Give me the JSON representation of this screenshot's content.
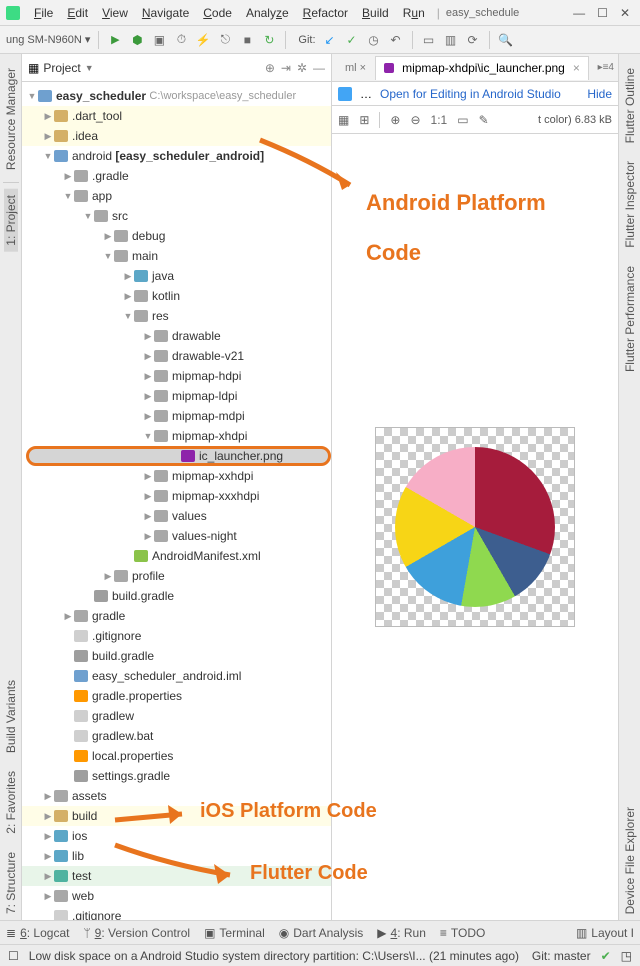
{
  "menu": {
    "file": "File",
    "edit": "Edit",
    "view": "View",
    "navigate": "Navigate",
    "code": "Code",
    "analyze": "Analyze",
    "refactor": "Refactor",
    "build": "Build",
    "run": "Run",
    "crumb": "easy_schedule"
  },
  "win": {
    "min": "—",
    "max": "☐",
    "close": "✕"
  },
  "toolbar": {
    "device": "ung SM-N960N ▾",
    "git": "Git:"
  },
  "project": {
    "header": "Project",
    "root": "easy_scheduler",
    "rootpath": "C:\\workspace\\easy_scheduler"
  },
  "tree": {
    "dart_tool": ".dart_tool",
    "idea": ".idea",
    "android": "android",
    "android_mod": "[easy_scheduler_android]",
    "gradle_dir": ".gradle",
    "app": "app",
    "src": "src",
    "debug": "debug",
    "main": "main",
    "java": "java",
    "kotlin": "kotlin",
    "res": "res",
    "drawable": "drawable",
    "drawable_v21": "drawable-v21",
    "mipmap_hdpi": "mipmap-hdpi",
    "mipmap_ldpi": "mipmap-ldpi",
    "mipmap_mdpi": "mipmap-mdpi",
    "mipmap_xhdpi": "mipmap-xhdpi",
    "ic_launcher": "ic_launcher.png",
    "mipmap_xxhdpi": "mipmap-xxhdpi",
    "mipmap_xxxhdpi": "mipmap-xxxhdpi",
    "values": "values",
    "values_night": "values-night",
    "manifest": "AndroidManifest.xml",
    "profile": "profile",
    "build_gradle": "build.gradle",
    "gradle": "gradle",
    "gitignore": ".gitignore",
    "iml": "easy_scheduler_android.iml",
    "gradle_props": "gradle.properties",
    "gradlew": "gradlew",
    "gradlew_bat": "gradlew.bat",
    "local_props": "local.properties",
    "settings_gradle": "settings.gradle",
    "assets": "assets",
    "build": "build",
    "ios": "ios",
    "lib": "lib",
    "test": "test",
    "web": "web",
    "gitignore2": ".gitignore"
  },
  "tab": {
    "inactive": "ml ×",
    "active": "mipmap-xhdpi\\ic_launcher.png",
    "tabcount": "▸≡4"
  },
  "editorbar": {
    "open": "Open for Editing in Android Studio",
    "hide": "Hide"
  },
  "imgbar": {
    "ratio": "1:1",
    "info": "t color) 6.83 kB"
  },
  "anno": {
    "android1": "Android Platform",
    "android2": "Code",
    "ios": "iOS Platform Code",
    "flutter": "Flutter Code"
  },
  "leftrail": {
    "rm": "Resource Manager",
    "proj": "1: Project",
    "bv": "Build Variants",
    "fav": "2: Favorites",
    "struct": "7: Structure"
  },
  "rightrail": {
    "fo": "Flutter Outline",
    "fi": "Flutter Inspector",
    "fp": "Flutter Performance",
    "de": "Device File Explorer",
    "li": "Layout I"
  },
  "bottom": {
    "logcat": "6: Logcat",
    "vc": "9: Version Control",
    "term": "Terminal",
    "dart": "Dart Analysis",
    "run": "4: Run",
    "todo": "TODO"
  },
  "status": {
    "msg": "Low disk space on a Android Studio system directory partition: C:\\Users\\I... (21 minutes ago)",
    "git": "Git: master"
  },
  "chart_data": {
    "type": "pie",
    "title": "ic_launcher.png",
    "series": [
      {
        "name": "dark-red",
        "color": "#a61c3c",
        "value": 31
      },
      {
        "name": "navy",
        "color": "#3d5e8f",
        "value": 11
      },
      {
        "name": "green",
        "color": "#8fd94f",
        "value": 11
      },
      {
        "name": "blue",
        "color": "#3ea0db",
        "value": 14
      },
      {
        "name": "yellow",
        "color": "#f7d516",
        "value": 17
      },
      {
        "name": "pink",
        "color": "#f7aec6",
        "value": 16
      }
    ]
  }
}
